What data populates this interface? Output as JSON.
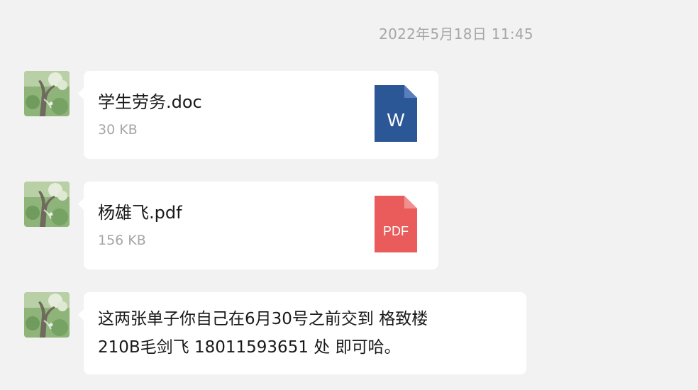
{
  "chat": {
    "timestamp": "2022年5月18日 11:45",
    "messages": [
      {
        "type": "file",
        "file_name": "学生劳务.doc",
        "file_size": "30 KB",
        "icon": "word-doc-icon",
        "icon_label": "W",
        "icon_color": "#2b5797"
      },
      {
        "type": "file",
        "file_name": "杨雄飞.pdf",
        "file_size": "156 KB",
        "icon": "pdf-file-icon",
        "icon_label": "PDF",
        "icon_color": "#ea5b5b"
      },
      {
        "type": "text",
        "line1": "这两张单子你自己在6月30号之前交到 格致楼",
        "line2": "210B毛剑飞 18011593651 处  即可哈。"
      }
    ]
  },
  "colors": {
    "background": "#f2f2f2",
    "bubble": "#ffffff",
    "secondary_text": "#a6a6a6"
  }
}
